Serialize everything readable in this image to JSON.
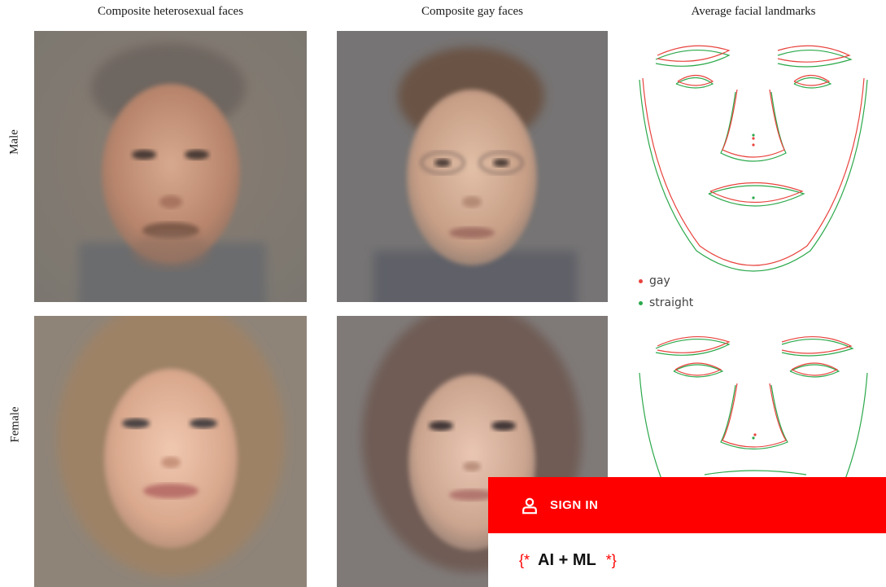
{
  "figure": {
    "columns": [
      "Composite heterosexual faces",
      "Composite gay faces",
      "Average facial landmarks"
    ],
    "rows": [
      "Male",
      "Female"
    ],
    "legend": [
      {
        "label": "gay",
        "color": "#e8433d"
      },
      {
        "label": "straight",
        "color": "#2ba84a"
      }
    ]
  },
  "overlay": {
    "sign_in_label": "SIGN IN",
    "sign_in_icon": "user-icon",
    "topic_open": "{*",
    "topic_label": "AI + ML",
    "topic_close": "*}",
    "accent": "#ff0000"
  }
}
